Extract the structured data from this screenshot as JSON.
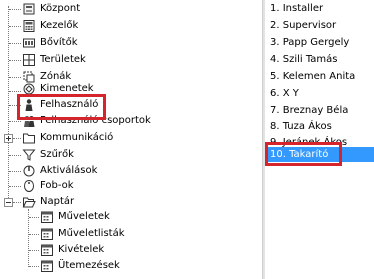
{
  "tree": {
    "items": [
      {
        "label": "Központ",
        "icon": "server-icon"
      },
      {
        "label": "Kezelők",
        "icon": "keypad-icon"
      },
      {
        "label": "Bővítők",
        "icon": "module-icon"
      },
      {
        "label": "Területek",
        "icon": "area-icon"
      },
      {
        "label": "Zónák",
        "icon": "zone-icon"
      },
      {
        "label": "Kimenetek",
        "icon": "output-icon"
      },
      {
        "label": "Felhasználó",
        "icon": "user-icon"
      },
      {
        "label": "Felhasználó csoportok",
        "icon": "user-group-icon"
      },
      {
        "label": "Kommunikáció",
        "icon": "folder-icon"
      },
      {
        "label": "Szűrők",
        "icon": "filter-icon"
      },
      {
        "label": "Aktiválások",
        "icon": "activation-icon"
      },
      {
        "label": "Fob-ok",
        "icon": "fob-icon"
      },
      {
        "label": "Naptár",
        "icon": "folder-open-icon"
      },
      {
        "label": "Műveletek",
        "icon": "calendar-icon"
      },
      {
        "label": "Műveletlisták",
        "icon": "calendar-icon"
      },
      {
        "label": "Kivételek",
        "icon": "calendar-icon"
      },
      {
        "label": "Ütemezések",
        "icon": "calendar-icon"
      }
    ]
  },
  "users": {
    "items": [
      "1. Installer",
      "2. Supervisor",
      "3. Papp Gergely",
      "4. Szili Tamás",
      "5. Kelemen Anita",
      "6. X Y",
      "7. Breznay Béla",
      "8. Tuza Ákos",
      "9. Jeránek Ákos",
      "10. Takarító"
    ],
    "selected_index": 9
  },
  "colors": {
    "selection": "#3399ff",
    "highlight_box": "#d4242c"
  }
}
